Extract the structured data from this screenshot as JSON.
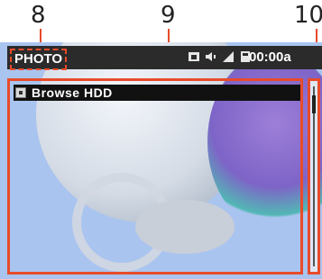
{
  "callouts": [
    "8",
    "9",
    "10"
  ],
  "status_bar": {
    "mode_label": "PHOTO",
    "icons": [
      "photo-icon",
      "volume-icon",
      "signal-icon",
      "battery-icon"
    ],
    "time": "00:00a"
  },
  "browser": {
    "item_label": "Browse HDD",
    "item_icon": "hdd-icon"
  },
  "colors": {
    "highlight": "#e84b2b",
    "status_bar_bg": "#2b2b2b",
    "screen_bg": "#a9c4ef"
  }
}
